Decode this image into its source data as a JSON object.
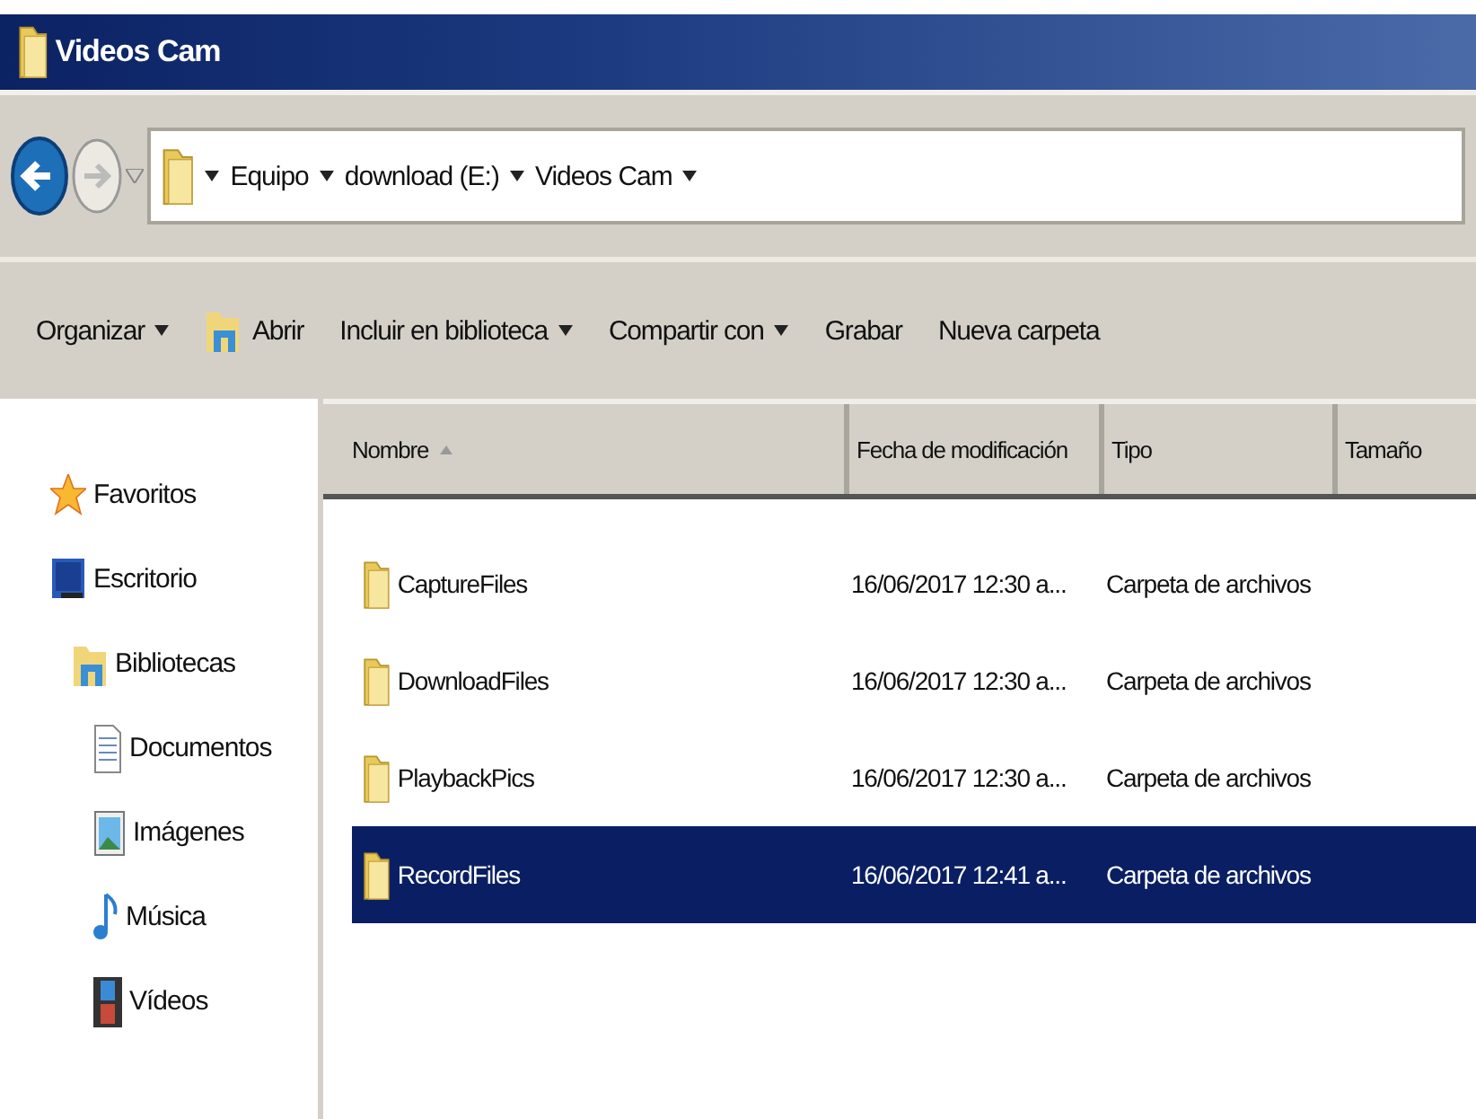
{
  "window": {
    "title": "Videos Cam"
  },
  "address_bar": {
    "segments": [
      "Equipo",
      "download (E:)",
      "Videos Cam"
    ]
  },
  "toolbar": [
    {
      "label": "Organizar",
      "has_menu": true,
      "kind": "plain"
    },
    {
      "label": "Abrir",
      "has_menu": false,
      "kind": "open"
    },
    {
      "label": "Incluir en biblioteca",
      "has_menu": true,
      "kind": "plain"
    },
    {
      "label": "Compartir con",
      "has_menu": true,
      "kind": "plain"
    },
    {
      "label": "Grabar",
      "has_menu": false,
      "kind": "plain"
    },
    {
      "label": "Nueva carpeta",
      "has_menu": false,
      "kind": "plain"
    }
  ],
  "sidebar": {
    "items": [
      {
        "label": "Favoritos",
        "kind": "star"
      },
      {
        "label": "Escritorio",
        "kind": "desktop",
        "children": [
          {
            "label": "Bibliotecas",
            "kind": "library",
            "children": [
              {
                "label": "Documentos",
                "kind": "document"
              },
              {
                "label": "Imágenes",
                "kind": "image"
              },
              {
                "label": "Música",
                "kind": "music"
              },
              {
                "label": "Vídeos",
                "kind": "video"
              }
            ]
          }
        ]
      }
    ]
  },
  "table": {
    "columns": [
      {
        "label": "Nombre",
        "sorted": true
      },
      {
        "label": "Fecha de modificación",
        "sorted": false
      },
      {
        "label": "Tipo",
        "sorted": false
      },
      {
        "label": "Tamaño",
        "sorted": false
      }
    ],
    "rows": [
      {
        "name": "CaptureFiles",
        "date": "16/06/2017 12:30 a...",
        "type": "Carpeta de archivos",
        "selected": false
      },
      {
        "name": "DownloadFiles",
        "date": "16/06/2017 12:30 a...",
        "type": "Carpeta de archivos",
        "selected": false
      },
      {
        "name": "PlaybackPics",
        "date": "16/06/2017 12:30 a...",
        "type": "Carpeta de archivos",
        "selected": false
      },
      {
        "name": "RecordFiles",
        "date": "16/06/2017 12:41 a...",
        "type": "Carpeta de archivos",
        "selected": true
      }
    ]
  }
}
